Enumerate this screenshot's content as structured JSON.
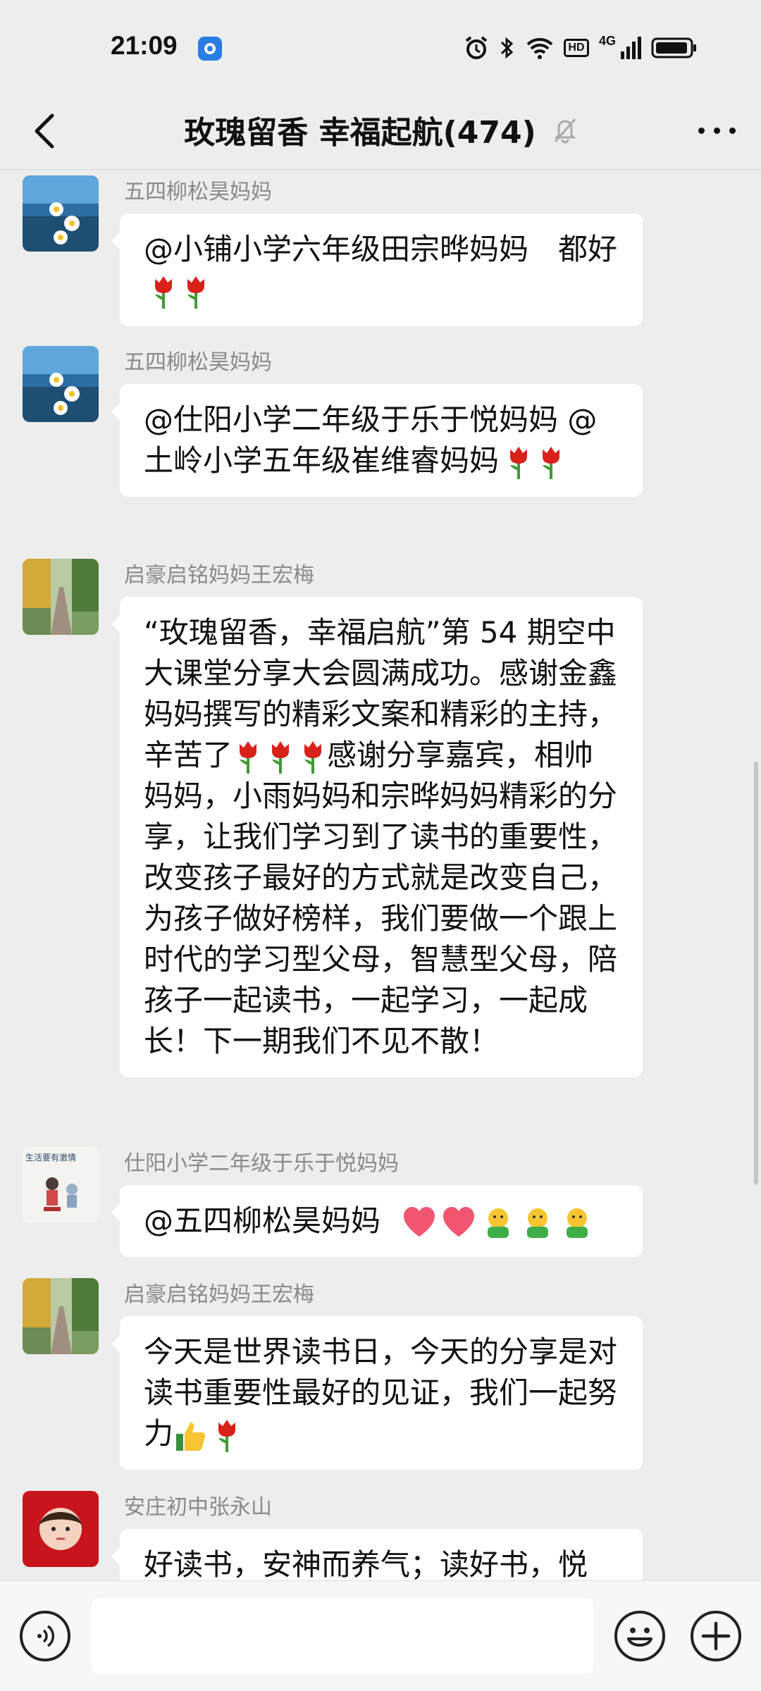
{
  "status_bar": {
    "time": "21:09",
    "network_label": "4G",
    "hd_label": "HD"
  },
  "header": {
    "title": "玫瑰留香 幸福起航(474)"
  },
  "messages": [
    {
      "sender": "五四柳松昊妈妈",
      "text": "@小铺小学六年级田宗晔妈妈　都好",
      "emojis": [
        "rose-icon",
        "rose-icon"
      ]
    },
    {
      "sender": "五四柳松昊妈妈",
      "text": "@仕阳小学二年级于乐于悦妈妈 @土岭小学五年级崔维睿妈妈",
      "emojis": [
        "rose-icon",
        "rose-icon"
      ]
    },
    {
      "sender": "启豪启铭妈妈王宏梅",
      "text_before": "“玫瑰留香，幸福启航”第 54 期空中大课堂分享大会圆满成功。感谢金鑫妈妈撰写的精彩文案和精彩的主持，辛苦了",
      "text_after": "感谢分享嘉宾，相帅妈妈，小雨妈妈和宗晔妈妈精彩的分享，让我们学习到了读书的重要性，改变孩子最好的方式就是改变自己，为孩子做好榜样，我们要做一个跟上时代的学习型父母，智慧型父母，陪孩子一起读书，一起学习，一起成长！下一期我们不见不散！",
      "emojis": [
        "rose-icon",
        "rose-icon",
        "rose-icon"
      ]
    },
    {
      "sender": "仕阳小学二年级于乐于悦妈妈",
      "text": "@五四柳松昊妈妈",
      "avatar_text": "生活要有激情",
      "emojis": [
        "heart-icon",
        "heart-icon",
        "hug-icon",
        "hug-icon",
        "hug-icon"
      ]
    },
    {
      "sender": "启豪启铭妈妈王宏梅",
      "text": "今天是世界读书日，今天的分享是对读书重要性最好的见证，我们一起努力",
      "emojis": [
        "thumbs-up-icon",
        "rose-icon"
      ]
    },
    {
      "sender": "安庄初中张永山",
      "text": "好读书，安神而养气；读好书，悦"
    }
  ],
  "input": {
    "placeholder": ""
  },
  "colors": {
    "background": "#ededed",
    "bubble": "#ffffff",
    "sender_name": "#8a8a8a"
  }
}
